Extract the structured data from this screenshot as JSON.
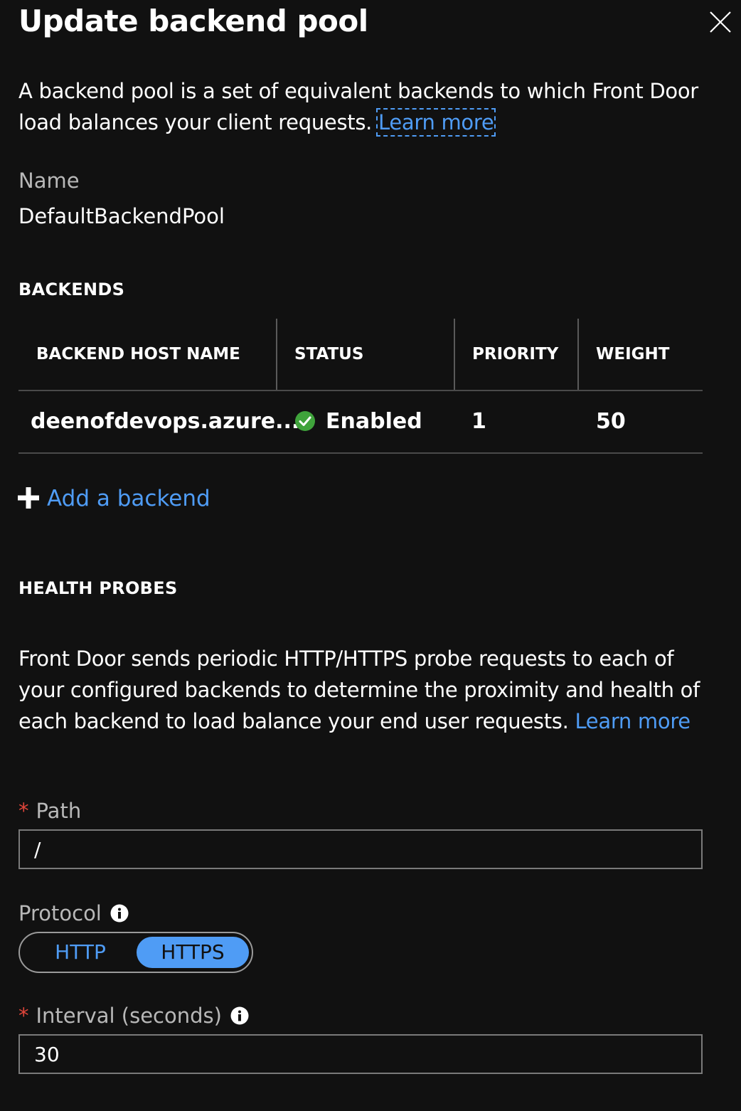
{
  "panel": {
    "title": "Update backend pool",
    "close_icon": "close-icon"
  },
  "intro": {
    "text": "A backend pool is a set of equivalent backends to which Front Door load balances your client requests.",
    "learn_more": "Learn more"
  },
  "name_field": {
    "label": "Name",
    "value": "DefaultBackendPool"
  },
  "backends": {
    "heading": "BACKENDS",
    "columns": [
      "BACKEND HOST NAME",
      "STATUS",
      "PRIORITY",
      "WEIGHT"
    ],
    "rows": [
      {
        "host": "deenofdevops.azure...",
        "status": "Enabled",
        "status_icon": "check-circle-icon",
        "status_color": "#3fa33b",
        "priority": "1",
        "weight": "50"
      }
    ],
    "add_label": "Add a backend"
  },
  "health_probes": {
    "heading": "HEALTH PROBES",
    "description": "Front Door sends periodic HTTP/HTTPS probe requests to each of your configured backends to determine the proximity and health of each backend to load balance your end user requests.",
    "learn_more": "Learn more",
    "path": {
      "label": "Path",
      "value": "/"
    },
    "protocol": {
      "label": "Protocol",
      "options": [
        "HTTP",
        "HTTPS"
      ],
      "selected": "HTTPS"
    },
    "interval": {
      "label": "Interval (seconds)",
      "value": "30"
    }
  },
  "colors": {
    "background": "#111111",
    "accent": "#4f9cf5",
    "required": "#e0453a",
    "success": "#3fa33b"
  }
}
